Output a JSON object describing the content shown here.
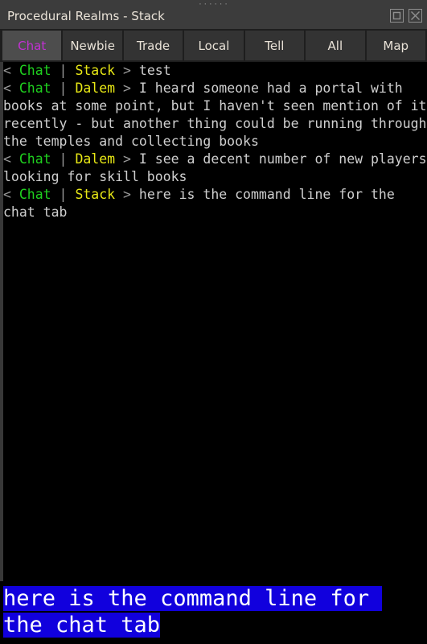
{
  "window": {
    "title": "Procedural Realms - Stack",
    "grip": "······",
    "buttons": [
      {
        "name": "maximize-restore-button",
        "icon": "maximize-icon",
        "label": "Maximize"
      },
      {
        "name": "close-button",
        "icon": "close-icon",
        "label": "Close"
      }
    ]
  },
  "tabs": [
    {
      "label": "Chat",
      "active": true,
      "color": "#c231d3"
    },
    {
      "label": "Newbie",
      "active": false,
      "color": "#e9e2d7"
    },
    {
      "label": "Trade",
      "active": false,
      "color": "#e9e2d7"
    },
    {
      "label": "Local",
      "active": false,
      "color": "#e9e2d7"
    },
    {
      "label": "Tell",
      "active": false,
      "color": "#e9e2d7"
    },
    {
      "label": "All",
      "active": false,
      "color": "#e9e2d7"
    },
    {
      "label": "Map",
      "active": false,
      "color": "#e9e2d7"
    }
  ],
  "chat": {
    "channel_color": "#1fd11f",
    "speaker_color": "#e8e815",
    "body_color": "#cfcfcf",
    "messages": [
      {
        "open": "< ",
        "channel": "Chat",
        "sep": " | ",
        "speaker": "Stack",
        "close": " > ",
        "text": "test"
      },
      {
        "open": "< ",
        "channel": "Chat",
        "sep": " | ",
        "speaker": "Dalem",
        "close": " > ",
        "text": "I heard someone had a portal with books at some point, but I haven't seen mention of it recently - but another thing could be running through the temples and collecting books"
      },
      {
        "open": "< ",
        "channel": "Chat",
        "sep": " | ",
        "speaker": "Dalem",
        "close": " > ",
        "text": "I see a decent number of new players looking for skill books"
      },
      {
        "open": "< ",
        "channel": "Chat",
        "sep": " | ",
        "speaker": "Stack",
        "close": " > ",
        "text": "here is the command line for the chat tab"
      }
    ]
  },
  "command_line": {
    "value": "here is the command line for the chat tab",
    "placeholder": "",
    "selected": true,
    "selection_color": "#1100dd",
    "text_color": "#ffffff"
  }
}
